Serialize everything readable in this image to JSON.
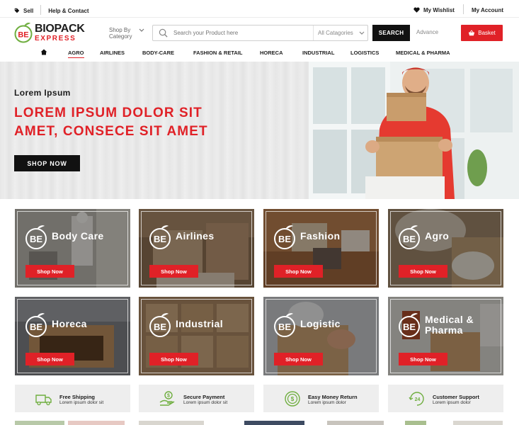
{
  "topbar": {
    "sell": "Sell",
    "help": "Help & Contact",
    "wishlist": "My Wishlist",
    "account": "My Account"
  },
  "header": {
    "logo_line1": "BIOPACK",
    "logo_line2": "EXPRESS",
    "logo_mark": "BE",
    "shop_by_line1": "Shop By",
    "shop_by_line2": "Category",
    "search_placeholder": "Search your Product here",
    "search_category": "All Catagories",
    "search_button": "SEARCH",
    "advance": "Advance",
    "basket": "Basket"
  },
  "nav": {
    "items": [
      "AGRO",
      "AIRLINES",
      "BODY-CARE",
      "FASHION & RETAIL",
      "HORECA",
      "INDUSTRIAL",
      "LOGISTICS",
      "MEDICAL & PHARMA"
    ],
    "active": "AGRO"
  },
  "hero": {
    "subtitle": "Lorem Ipsum",
    "headline_line1": "LOREM IPSUM DOLOR SIT",
    "headline_line2": "AMET, CONSECE SIT AMET",
    "button": "SHOP NOW"
  },
  "categories": [
    {
      "title": "Body Care",
      "button": "Shop Now"
    },
    {
      "title": "Airlines",
      "button": "Shop Now"
    },
    {
      "title": "Fashion",
      "button": "Shop Now"
    },
    {
      "title": "Agro",
      "button": "Shop Now"
    },
    {
      "title": "Horeca",
      "button": "Shop Now"
    },
    {
      "title": "Industrial",
      "button": "Shop Now"
    },
    {
      "title": "Logistic",
      "button": "Shop Now"
    },
    {
      "title_line1": "Medical &",
      "title_line2": "Pharma",
      "button": "Shop Now"
    }
  ],
  "features": [
    {
      "title": "Free Shipping",
      "subtitle": "Lorem ipsum dolor sit",
      "icon": "truck-icon"
    },
    {
      "title": "Secure Payment",
      "subtitle": "Lorem ipsum dolor sit",
      "icon": "hand-coin-icon"
    },
    {
      "title": "Easy Money Return",
      "subtitle": "Lorem ipsum dolor",
      "icon": "money-return-icon"
    },
    {
      "title": "Customer Support",
      "subtitle": "Lorem ipsum dolor",
      "icon": "support-24-icon"
    }
  ],
  "colors": {
    "brand_red": "#e02127",
    "brand_green": "#6fae3f",
    "dark": "#111111"
  }
}
